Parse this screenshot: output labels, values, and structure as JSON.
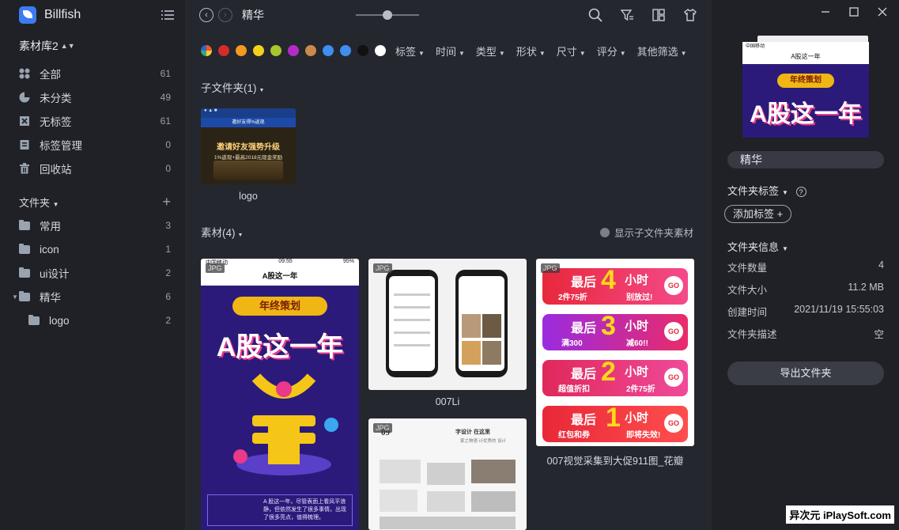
{
  "app": {
    "title": "Billfish"
  },
  "library": {
    "name": "素材库2"
  },
  "sidebar": {
    "nav": [
      {
        "label": "全部",
        "count": "61",
        "icon": "all-items-icon"
      },
      {
        "label": "未分类",
        "count": "49",
        "icon": "pie-chart-icon"
      },
      {
        "label": "无标签",
        "count": "61",
        "icon": "no-tag-icon"
      },
      {
        "label": "标签管理",
        "count": "0",
        "icon": "tag-manage-icon"
      },
      {
        "label": "回收站",
        "count": "0",
        "icon": "trash-icon"
      }
    ],
    "folders_header": "文件夹",
    "folders": [
      {
        "label": "常用",
        "count": "3"
      },
      {
        "label": "icon",
        "count": "1"
      },
      {
        "label": "ui设计",
        "count": "2"
      },
      {
        "label": "精华",
        "count": "6"
      },
      {
        "label": "logo",
        "count": "2"
      }
    ]
  },
  "main": {
    "breadcrumb": "精华",
    "colors": [
      "#d62b2b",
      "#f39a1f",
      "#f3d21a",
      "#a6c72c",
      "#b32cc8",
      "#c98a4c",
      "#3d8ff0",
      "#3d8ff0",
      "#111111",
      "#ffffff"
    ],
    "filters": [
      "标签",
      "时间",
      "类型",
      "形状",
      "尺寸",
      "评分",
      "其他筛选"
    ],
    "subfolder_label": "子文件夹(1)",
    "subfolder": {
      "caption": "logo",
      "title": "邀好友得%返现",
      "headline": "邀请好友强势升级",
      "subline": "1%返现+最高2018元现金奖励"
    },
    "assets_label": "素材(4)",
    "show_sub_label": "显示子文件夹素材",
    "assets": [
      {
        "format": "JPG",
        "caption": "",
        "status_left": "中国移动",
        "status_time": "09:55",
        "status_right": "95%",
        "page_title": "A股这一年",
        "badge": "年终策划",
        "headline": "A股这一年",
        "body": "A 股这一年，尽管表面上看风平浪静，但依然发生了很多事情，出现了很多亮点，值得梳理。"
      },
      {
        "format": "JPG",
        "caption": "007Li"
      },
      {
        "format": "JPG",
        "caption": "",
        "doc_title": "字设计 在这里",
        "doc_subtitle": "家之物语 计优秀的 设计",
        "page_no": "09"
      },
      {
        "format": "JPG",
        "caption": "007视觉采集到大促911图_花瓣",
        "banners": [
          {
            "big": "最后",
            "num": "4",
            "unit": "小时",
            "sub1": "2件75折",
            "sub2": "别放过!"
          },
          {
            "big": "最后",
            "num": "3",
            "unit": "小时",
            "sub1": "满300",
            "sub2": "减60!!"
          },
          {
            "big": "最后",
            "num": "2",
            "unit": "小时",
            "sub1": "超值折扣",
            "sub2": "2件75折"
          },
          {
            "big": "最后",
            "num": "1",
            "unit": "小时",
            "sub1": "红包和券",
            "sub2": "即将失效!"
          }
        ]
      }
    ]
  },
  "right": {
    "preview_title": "A股这一年",
    "preview_badge": "年终策划",
    "preview_headline": "A股这一年",
    "preview_status_left": "中国移动",
    "folder_name": "精华",
    "folder_tags_label": "文件夹标签",
    "add_tag_label": "添加标签",
    "folder_info_label": "文件夹信息",
    "info": [
      {
        "key": "文件数量",
        "value": "4"
      },
      {
        "key": "文件大小",
        "value": "11.2 MB"
      },
      {
        "key": "创建时间",
        "value": "2021/11/19 15:55:03"
      },
      {
        "key": "文件夹描述",
        "value": "空"
      }
    ],
    "export_label": "导出文件夹"
  },
  "watermark": "异次元 iPlaySoft.com"
}
